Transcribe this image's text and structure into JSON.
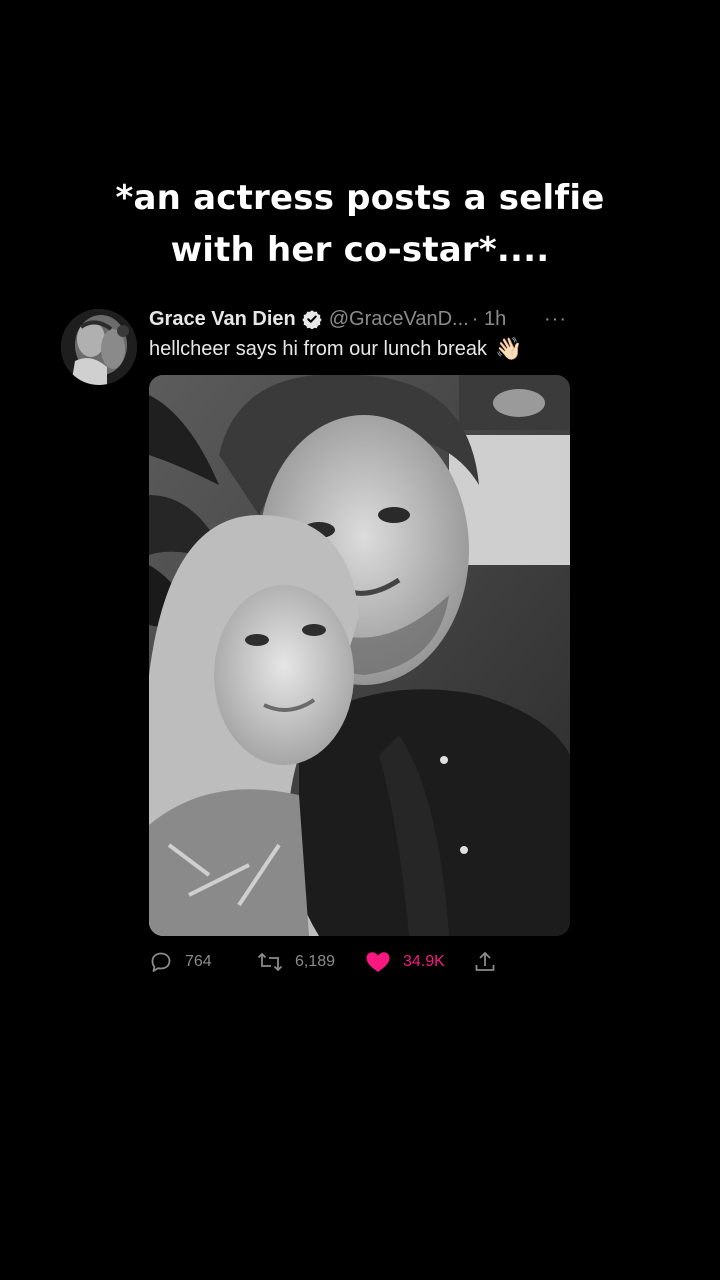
{
  "caption": {
    "line1": "*an actress posts a selfie",
    "line2": "with her co-star*...."
  },
  "tweet": {
    "author": {
      "display_name": "Grace Van Dien",
      "verified": true,
      "handle": "@GraceVanD...",
      "avatar_icon": "avatar-photo"
    },
    "time": "· 1h",
    "more_label": "···",
    "text": "hellcheer says hi from our lunch break",
    "emoji": "👋🏻",
    "photo": {
      "kind": "black-and-white selfie",
      "icon": "photo-image"
    },
    "actions": {
      "replies": "764",
      "retweets": "6,189",
      "likes": "34.9K",
      "liked": true,
      "like_color": "#f91880",
      "muted_color": "#8b8b8b",
      "verified_color": "#e7e7e7"
    }
  }
}
